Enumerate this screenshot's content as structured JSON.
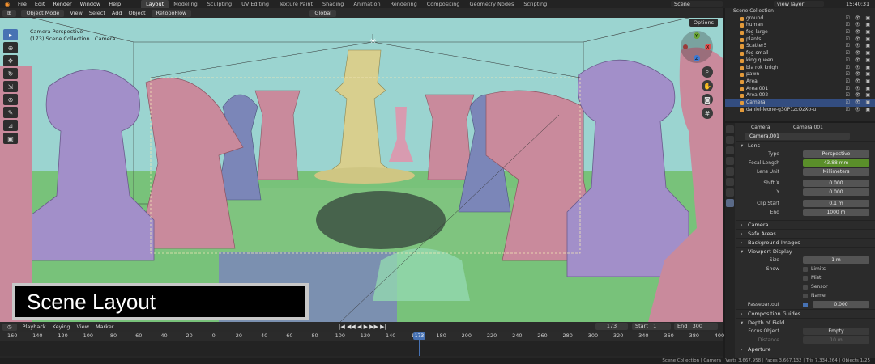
{
  "topbar": {
    "menus": [
      "File",
      "Edit",
      "Render",
      "Window",
      "Help"
    ],
    "workspaces": [
      "Layout",
      "Modeling",
      "Sculpting",
      "UV Editing",
      "Texture Paint",
      "Shading",
      "Animation",
      "Rendering",
      "Compositing",
      "Geometry Nodes",
      "Scripting"
    ],
    "active_workspace": "Layout",
    "scene": "Scene",
    "view_layer": "view layer",
    "time": "15:40:31"
  },
  "viewport_header": {
    "mode": "Object Mode",
    "menus": [
      "View",
      "Select",
      "Add",
      "Object"
    ],
    "retopo": "RetopoFlow",
    "orientation": "Global"
  },
  "viewport": {
    "title_line1": "Camera Perspective",
    "title_line2": "(173) Scene Collection | Camera",
    "options": "Options",
    "overlay_label": "Scene Layout",
    "colors": {
      "background": "#9bd4d0",
      "ground": "#78c27a",
      "queen": "#d8cf8e",
      "purple": "#a28fc9",
      "pink": "#c98a9c",
      "blue": "#7b86b8"
    }
  },
  "timeline": {
    "menus": [
      "Playback",
      "Keying",
      "View",
      "Marker"
    ],
    "current_frame": "173",
    "start_label": "Start",
    "start": "1",
    "end_label": "End",
    "end": "300",
    "ticks": [
      "-160",
      "-140",
      "-120",
      "-100",
      "-80",
      "-60",
      "-40",
      "-20",
      "0",
      "20",
      "40",
      "60",
      "80",
      "100",
      "120",
      "140",
      "160",
      "180",
      "200",
      "220",
      "240",
      "260",
      "280",
      "300",
      "320",
      "340",
      "360",
      "380",
      "400"
    ],
    "frame_marker": "173"
  },
  "outliner": {
    "header": "Scene Collection",
    "items": [
      {
        "name": "ground",
        "selected": false
      },
      {
        "name": "human",
        "selected": false
      },
      {
        "name": "fog large",
        "selected": false
      },
      {
        "name": "plants",
        "selected": false
      },
      {
        "name": "Scatter5",
        "selected": false
      },
      {
        "name": "fog small",
        "selected": false
      },
      {
        "name": "king queen",
        "selected": false
      },
      {
        "name": "bla rok knigh",
        "selected": false
      },
      {
        "name": "pawn",
        "selected": false
      },
      {
        "name": "Area",
        "selected": false
      },
      {
        "name": "Area.001",
        "selected": false
      },
      {
        "name": "Area.002",
        "selected": false
      },
      {
        "name": "Camera",
        "selected": true
      },
      {
        "name": "daniel-leone-g30P1zcOzXo-u",
        "selected": false
      }
    ]
  },
  "properties": {
    "breadcrumb_obj": "Camera",
    "breadcrumb_data": "Camera.001",
    "datablock": "Camera.001",
    "lens_section": "Lens",
    "type_label": "Type",
    "type_value": "Perspective",
    "focal_label": "Focal Length",
    "focal_value": "43.88 mm",
    "lens_unit_label": "Lens Unit",
    "lens_unit_value": "Millimeters",
    "shift_x_label": "Shift X",
    "shift_x_value": "0.000",
    "y_label": "Y",
    "y_value": "0.000",
    "clip_start_label": "Clip Start",
    "clip_start_value": "0.1 m",
    "end_label": "End",
    "end_value": "1000 m",
    "sections": [
      "Camera",
      "Safe Areas",
      "Background Images"
    ],
    "viewport_display": "Viewport Display",
    "size_label": "Size",
    "size_value": "1 m",
    "show_label": "Show",
    "show_items": [
      "Limits",
      "Mist",
      "Sensor",
      "Name"
    ],
    "passepartout_label": "Passepartout",
    "passepartout_value": "0.000",
    "composition_guides": "Composition Guides",
    "dof": "Depth of Field",
    "focus_label": "Focus Object",
    "focus_value": "Empty",
    "distance_label": "Distance",
    "distance_value": "10 m",
    "aperture": "Aperture"
  },
  "status_bar": "Scene Collection | Camera | Verts 3,667,958 | Faces 3,667,132 | Tris 7,334,264 | Objects 1/25"
}
